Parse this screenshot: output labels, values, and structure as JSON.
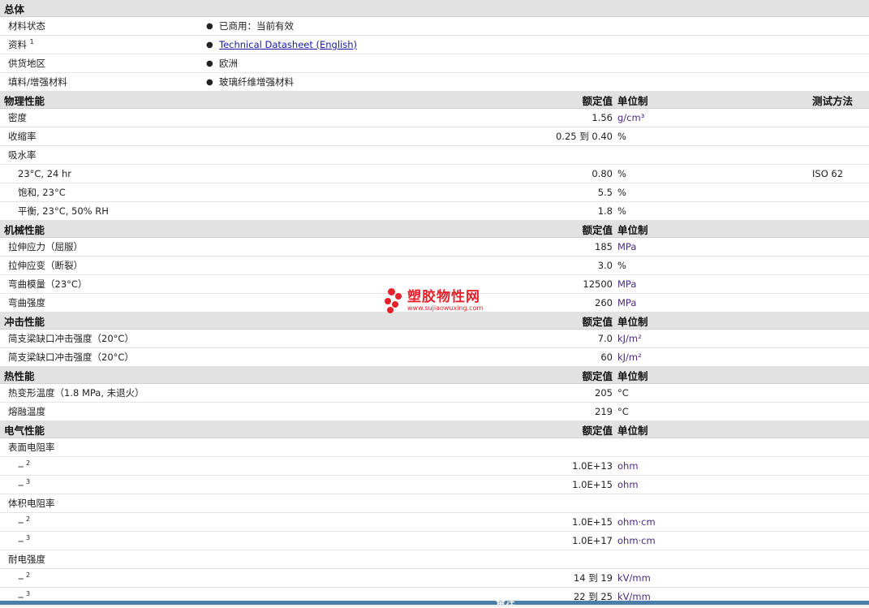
{
  "general": {
    "title": "总体",
    "rows": [
      {
        "label": "材料状态",
        "value": "已商用：当前有效"
      },
      {
        "label": "资料",
        "sup": "1",
        "link": "Technical Datasheet (English)"
      },
      {
        "label": "供货地区",
        "value": "欧洲"
      },
      {
        "label": "填料/增强材料",
        "value": "玻璃纤维增强材料"
      }
    ]
  },
  "headers": {
    "value": "额定值",
    "unit": "单位制",
    "test": "测试方法"
  },
  "physical": {
    "title": "物理性能",
    "rows": [
      {
        "label": "密度",
        "value": "1.56",
        "unit": "g/cm³"
      },
      {
        "label": "收缩率",
        "value": "0.25 到  0.40",
        "unit": "%"
      },
      {
        "label": "吸水率",
        "value": "",
        "unit": ""
      },
      {
        "label": "23°C, 24 hr",
        "value": "0.80",
        "unit": "%",
        "test": "ISO 62"
      },
      {
        "label": "饱和, 23°C",
        "value": "5.5",
        "unit": "%"
      },
      {
        "label": "平衡, 23°C, 50% RH",
        "value": "1.8",
        "unit": "%"
      }
    ]
  },
  "mechanical": {
    "title": "机械性能",
    "rows": [
      {
        "label": "拉伸应力（屈服）",
        "value": "185",
        "unit": "MPa"
      },
      {
        "label": "拉伸应变（断裂）",
        "value": "3.0",
        "unit": "%"
      },
      {
        "label": "弯曲模量（23°C）",
        "value": "12500",
        "unit": "MPa"
      },
      {
        "label": "弯曲强度",
        "value": "260",
        "unit": "MPa"
      }
    ]
  },
  "impact": {
    "title": "冲击性能",
    "rows": [
      {
        "label": "简支梁缺口冲击强度（20°C）",
        "value": "7.0",
        "unit": "kJ/m²"
      },
      {
        "label": "简支梁缺口冲击强度（20°C）",
        "value": "60",
        "unit": "kJ/m²"
      }
    ]
  },
  "thermal": {
    "title": "热性能",
    "rows": [
      {
        "label": "热变形温度（1.8 MPa, 未退火）",
        "value": "205",
        "unit": "°C"
      },
      {
        "label": "熔融温度",
        "value": "219",
        "unit": "°C"
      }
    ]
  },
  "electrical": {
    "title": "电气性能",
    "rows": [
      {
        "label": "表面电阻率"
      },
      {
        "label": "--",
        "sup": "2",
        "value": "1.0E+13",
        "unit": "ohm"
      },
      {
        "label": "--",
        "sup": "3",
        "value": "1.0E+15",
        "unit": "ohm"
      },
      {
        "label": "体积电阻率"
      },
      {
        "label": "--",
        "sup": "2",
        "value": "1.0E+15",
        "unit": "ohm·cm"
      },
      {
        "label": "--",
        "sup": "3",
        "value": "1.0E+17",
        "unit": "ohm·cm"
      },
      {
        "label": "耐电强度"
      },
      {
        "label": "--",
        "sup": "2",
        "value": "14 到  19",
        "unit": "kV/mm"
      },
      {
        "label": "--",
        "sup": "3",
        "value": "22 到  25",
        "unit": "kV/mm"
      }
    ]
  },
  "watermark": {
    "cn": "塑胶物性网",
    "en": "www.sujiaowuxing.com"
  },
  "footer": {
    "label": "备注"
  },
  "colors": {
    "header_bg": "#e2e2e2",
    "link": "#1a1aa6",
    "unit_purple": "#4b2a7b",
    "brand_red": "#e8202a",
    "bar": "#4a7ea8"
  }
}
